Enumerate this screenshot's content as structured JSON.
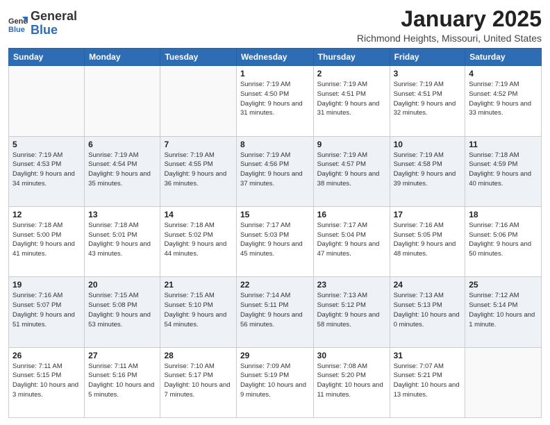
{
  "header": {
    "logo_general": "General",
    "logo_blue": "Blue",
    "month_title": "January 2025",
    "location": "Richmond Heights, Missouri, United States"
  },
  "weekdays": [
    "Sunday",
    "Monday",
    "Tuesday",
    "Wednesday",
    "Thursday",
    "Friday",
    "Saturday"
  ],
  "weeks": [
    [
      {
        "day": "",
        "info": ""
      },
      {
        "day": "",
        "info": ""
      },
      {
        "day": "",
        "info": ""
      },
      {
        "day": "1",
        "info": "Sunrise: 7:19 AM\nSunset: 4:50 PM\nDaylight: 9 hours and 31 minutes."
      },
      {
        "day": "2",
        "info": "Sunrise: 7:19 AM\nSunset: 4:51 PM\nDaylight: 9 hours and 31 minutes."
      },
      {
        "day": "3",
        "info": "Sunrise: 7:19 AM\nSunset: 4:51 PM\nDaylight: 9 hours and 32 minutes."
      },
      {
        "day": "4",
        "info": "Sunrise: 7:19 AM\nSunset: 4:52 PM\nDaylight: 9 hours and 33 minutes."
      }
    ],
    [
      {
        "day": "5",
        "info": "Sunrise: 7:19 AM\nSunset: 4:53 PM\nDaylight: 9 hours and 34 minutes."
      },
      {
        "day": "6",
        "info": "Sunrise: 7:19 AM\nSunset: 4:54 PM\nDaylight: 9 hours and 35 minutes."
      },
      {
        "day": "7",
        "info": "Sunrise: 7:19 AM\nSunset: 4:55 PM\nDaylight: 9 hours and 36 minutes."
      },
      {
        "day": "8",
        "info": "Sunrise: 7:19 AM\nSunset: 4:56 PM\nDaylight: 9 hours and 37 minutes."
      },
      {
        "day": "9",
        "info": "Sunrise: 7:19 AM\nSunset: 4:57 PM\nDaylight: 9 hours and 38 minutes."
      },
      {
        "day": "10",
        "info": "Sunrise: 7:19 AM\nSunset: 4:58 PM\nDaylight: 9 hours and 39 minutes."
      },
      {
        "day": "11",
        "info": "Sunrise: 7:18 AM\nSunset: 4:59 PM\nDaylight: 9 hours and 40 minutes."
      }
    ],
    [
      {
        "day": "12",
        "info": "Sunrise: 7:18 AM\nSunset: 5:00 PM\nDaylight: 9 hours and 41 minutes."
      },
      {
        "day": "13",
        "info": "Sunrise: 7:18 AM\nSunset: 5:01 PM\nDaylight: 9 hours and 43 minutes."
      },
      {
        "day": "14",
        "info": "Sunrise: 7:18 AM\nSunset: 5:02 PM\nDaylight: 9 hours and 44 minutes."
      },
      {
        "day": "15",
        "info": "Sunrise: 7:17 AM\nSunset: 5:03 PM\nDaylight: 9 hours and 45 minutes."
      },
      {
        "day": "16",
        "info": "Sunrise: 7:17 AM\nSunset: 5:04 PM\nDaylight: 9 hours and 47 minutes."
      },
      {
        "day": "17",
        "info": "Sunrise: 7:16 AM\nSunset: 5:05 PM\nDaylight: 9 hours and 48 minutes."
      },
      {
        "day": "18",
        "info": "Sunrise: 7:16 AM\nSunset: 5:06 PM\nDaylight: 9 hours and 50 minutes."
      }
    ],
    [
      {
        "day": "19",
        "info": "Sunrise: 7:16 AM\nSunset: 5:07 PM\nDaylight: 9 hours and 51 minutes."
      },
      {
        "day": "20",
        "info": "Sunrise: 7:15 AM\nSunset: 5:08 PM\nDaylight: 9 hours and 53 minutes."
      },
      {
        "day": "21",
        "info": "Sunrise: 7:15 AM\nSunset: 5:10 PM\nDaylight: 9 hours and 54 minutes."
      },
      {
        "day": "22",
        "info": "Sunrise: 7:14 AM\nSunset: 5:11 PM\nDaylight: 9 hours and 56 minutes."
      },
      {
        "day": "23",
        "info": "Sunrise: 7:13 AM\nSunset: 5:12 PM\nDaylight: 9 hours and 58 minutes."
      },
      {
        "day": "24",
        "info": "Sunrise: 7:13 AM\nSunset: 5:13 PM\nDaylight: 10 hours and 0 minutes."
      },
      {
        "day": "25",
        "info": "Sunrise: 7:12 AM\nSunset: 5:14 PM\nDaylight: 10 hours and 1 minute."
      }
    ],
    [
      {
        "day": "26",
        "info": "Sunrise: 7:11 AM\nSunset: 5:15 PM\nDaylight: 10 hours and 3 minutes."
      },
      {
        "day": "27",
        "info": "Sunrise: 7:11 AM\nSunset: 5:16 PM\nDaylight: 10 hours and 5 minutes."
      },
      {
        "day": "28",
        "info": "Sunrise: 7:10 AM\nSunset: 5:17 PM\nDaylight: 10 hours and 7 minutes."
      },
      {
        "day": "29",
        "info": "Sunrise: 7:09 AM\nSunset: 5:19 PM\nDaylight: 10 hours and 9 minutes."
      },
      {
        "day": "30",
        "info": "Sunrise: 7:08 AM\nSunset: 5:20 PM\nDaylight: 10 hours and 11 minutes."
      },
      {
        "day": "31",
        "info": "Sunrise: 7:07 AM\nSunset: 5:21 PM\nDaylight: 10 hours and 13 minutes."
      },
      {
        "day": "",
        "info": ""
      }
    ]
  ]
}
